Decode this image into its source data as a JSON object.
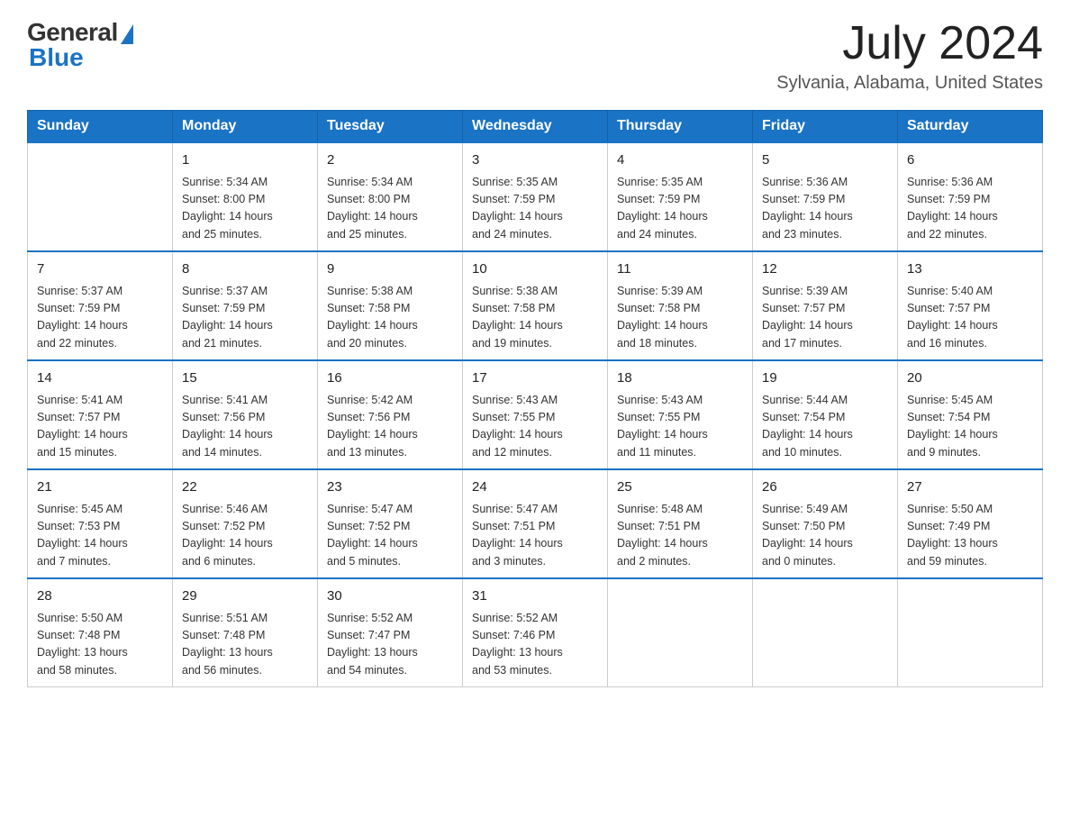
{
  "header": {
    "logo_general": "General",
    "logo_blue": "Blue",
    "month_title": "July 2024",
    "location": "Sylvania, Alabama, United States"
  },
  "days_of_week": [
    "Sunday",
    "Monday",
    "Tuesday",
    "Wednesday",
    "Thursday",
    "Friday",
    "Saturday"
  ],
  "weeks": [
    [
      {
        "day": "",
        "info": ""
      },
      {
        "day": "1",
        "info": "Sunrise: 5:34 AM\nSunset: 8:00 PM\nDaylight: 14 hours\nand 25 minutes."
      },
      {
        "day": "2",
        "info": "Sunrise: 5:34 AM\nSunset: 8:00 PM\nDaylight: 14 hours\nand 25 minutes."
      },
      {
        "day": "3",
        "info": "Sunrise: 5:35 AM\nSunset: 7:59 PM\nDaylight: 14 hours\nand 24 minutes."
      },
      {
        "day": "4",
        "info": "Sunrise: 5:35 AM\nSunset: 7:59 PM\nDaylight: 14 hours\nand 24 minutes."
      },
      {
        "day": "5",
        "info": "Sunrise: 5:36 AM\nSunset: 7:59 PM\nDaylight: 14 hours\nand 23 minutes."
      },
      {
        "day": "6",
        "info": "Sunrise: 5:36 AM\nSunset: 7:59 PM\nDaylight: 14 hours\nand 22 minutes."
      }
    ],
    [
      {
        "day": "7",
        "info": "Sunrise: 5:37 AM\nSunset: 7:59 PM\nDaylight: 14 hours\nand 22 minutes."
      },
      {
        "day": "8",
        "info": "Sunrise: 5:37 AM\nSunset: 7:59 PM\nDaylight: 14 hours\nand 21 minutes."
      },
      {
        "day": "9",
        "info": "Sunrise: 5:38 AM\nSunset: 7:58 PM\nDaylight: 14 hours\nand 20 minutes."
      },
      {
        "day": "10",
        "info": "Sunrise: 5:38 AM\nSunset: 7:58 PM\nDaylight: 14 hours\nand 19 minutes."
      },
      {
        "day": "11",
        "info": "Sunrise: 5:39 AM\nSunset: 7:58 PM\nDaylight: 14 hours\nand 18 minutes."
      },
      {
        "day": "12",
        "info": "Sunrise: 5:39 AM\nSunset: 7:57 PM\nDaylight: 14 hours\nand 17 minutes."
      },
      {
        "day": "13",
        "info": "Sunrise: 5:40 AM\nSunset: 7:57 PM\nDaylight: 14 hours\nand 16 minutes."
      }
    ],
    [
      {
        "day": "14",
        "info": "Sunrise: 5:41 AM\nSunset: 7:57 PM\nDaylight: 14 hours\nand 15 minutes."
      },
      {
        "day": "15",
        "info": "Sunrise: 5:41 AM\nSunset: 7:56 PM\nDaylight: 14 hours\nand 14 minutes."
      },
      {
        "day": "16",
        "info": "Sunrise: 5:42 AM\nSunset: 7:56 PM\nDaylight: 14 hours\nand 13 minutes."
      },
      {
        "day": "17",
        "info": "Sunrise: 5:43 AM\nSunset: 7:55 PM\nDaylight: 14 hours\nand 12 minutes."
      },
      {
        "day": "18",
        "info": "Sunrise: 5:43 AM\nSunset: 7:55 PM\nDaylight: 14 hours\nand 11 minutes."
      },
      {
        "day": "19",
        "info": "Sunrise: 5:44 AM\nSunset: 7:54 PM\nDaylight: 14 hours\nand 10 minutes."
      },
      {
        "day": "20",
        "info": "Sunrise: 5:45 AM\nSunset: 7:54 PM\nDaylight: 14 hours\nand 9 minutes."
      }
    ],
    [
      {
        "day": "21",
        "info": "Sunrise: 5:45 AM\nSunset: 7:53 PM\nDaylight: 14 hours\nand 7 minutes."
      },
      {
        "day": "22",
        "info": "Sunrise: 5:46 AM\nSunset: 7:52 PM\nDaylight: 14 hours\nand 6 minutes."
      },
      {
        "day": "23",
        "info": "Sunrise: 5:47 AM\nSunset: 7:52 PM\nDaylight: 14 hours\nand 5 minutes."
      },
      {
        "day": "24",
        "info": "Sunrise: 5:47 AM\nSunset: 7:51 PM\nDaylight: 14 hours\nand 3 minutes."
      },
      {
        "day": "25",
        "info": "Sunrise: 5:48 AM\nSunset: 7:51 PM\nDaylight: 14 hours\nand 2 minutes."
      },
      {
        "day": "26",
        "info": "Sunrise: 5:49 AM\nSunset: 7:50 PM\nDaylight: 14 hours\nand 0 minutes."
      },
      {
        "day": "27",
        "info": "Sunrise: 5:50 AM\nSunset: 7:49 PM\nDaylight: 13 hours\nand 59 minutes."
      }
    ],
    [
      {
        "day": "28",
        "info": "Sunrise: 5:50 AM\nSunset: 7:48 PM\nDaylight: 13 hours\nand 58 minutes."
      },
      {
        "day": "29",
        "info": "Sunrise: 5:51 AM\nSunset: 7:48 PM\nDaylight: 13 hours\nand 56 minutes."
      },
      {
        "day": "30",
        "info": "Sunrise: 5:52 AM\nSunset: 7:47 PM\nDaylight: 13 hours\nand 54 minutes."
      },
      {
        "day": "31",
        "info": "Sunrise: 5:52 AM\nSunset: 7:46 PM\nDaylight: 13 hours\nand 53 minutes."
      },
      {
        "day": "",
        "info": ""
      },
      {
        "day": "",
        "info": ""
      },
      {
        "day": "",
        "info": ""
      }
    ]
  ]
}
